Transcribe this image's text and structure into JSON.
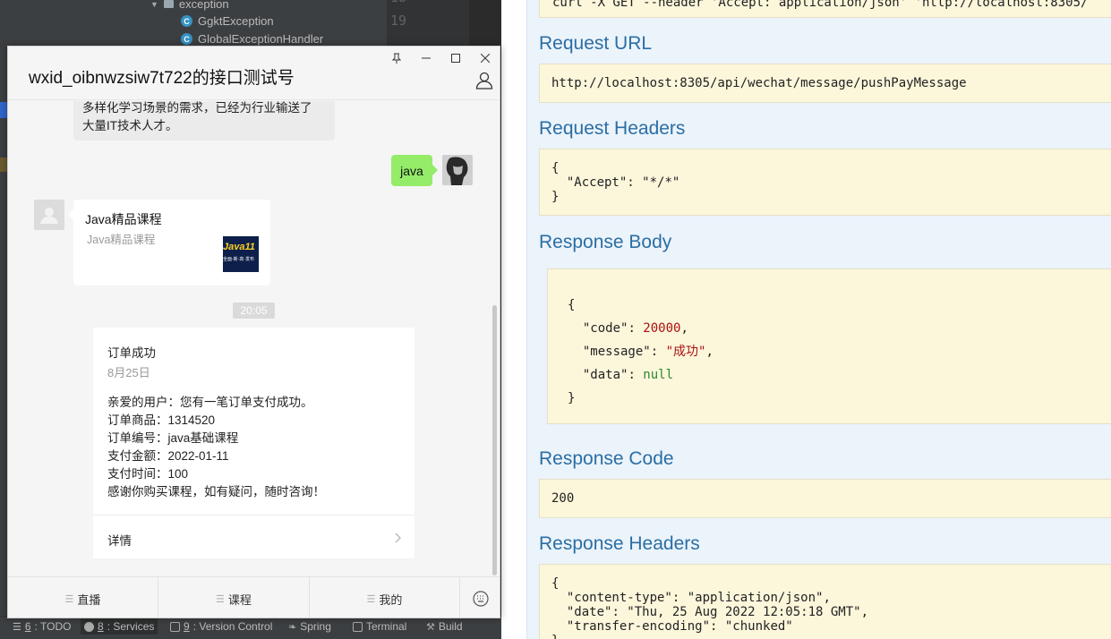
{
  "ide": {
    "tree": {
      "folder": "exception",
      "classes": [
        "GgktException",
        "GlobalExceptionHandler"
      ]
    },
    "line_numbers": [
      "19"
    ],
    "toolwindows": [
      {
        "num": "6",
        "label": ": TODO"
      },
      {
        "num": "8",
        "label": ": Services"
      },
      {
        "num": "9",
        "label": ": Version Control"
      },
      {
        "label": "Spring"
      },
      {
        "label": "Terminal"
      },
      {
        "label": "Build"
      }
    ]
  },
  "wechat": {
    "title": "wxid_oibnwzsiw7t722的接口测试号",
    "window_controls": {
      "pin": "⊥",
      "minimize": "—",
      "maximize": "☐",
      "close": "✕"
    },
    "messages": {
      "incoming_text": [
        "多样化学习场景的需求，已经为行业输送了",
        "大量IT技术人才。"
      ],
      "outgoing_text": "java",
      "link_card": {
        "title": "Java精品课程",
        "desc": "Java精品课程",
        "thumb_text": "Java11",
        "thumb_sub": "全面·新·高·发布"
      },
      "time": "20:05",
      "template": {
        "title": "订单成功",
        "date": "8月25日",
        "lines": [
          "亲爱的用户：您有一笔订单支付成功。",
          "订单商品：1314520",
          "订单编号：java基础课程",
          "支付金额：2022-01-11",
          "支付时间：100",
          "感谢你购买课程，如有疑问，随时咨询！"
        ],
        "detail_label": "详情"
      }
    },
    "menu": [
      "直播",
      "课程",
      "我的"
    ]
  },
  "swagger": {
    "curl_partial": "curl -X GET --header 'Accept: application/json' 'http://localhost:8305/",
    "request_url_heading": "Request URL",
    "request_url": "http://localhost:8305/api/wechat/message/pushPayMessage",
    "request_headers_heading": "Request Headers",
    "request_headers": {
      "key": "\"Accept\"",
      "value": "\"*/*\""
    },
    "response_body_heading": "Response Body",
    "response_body": {
      "code_key": "\"code\"",
      "code_val": "20000",
      "message_key": "\"message\"",
      "message_val": "\"成功\"",
      "data_key": "\"data\"",
      "data_val": "null"
    },
    "response_code_heading": "Response Code",
    "response_code": "200",
    "response_headers_heading": "Response Headers",
    "response_headers": [
      {
        "key": "\"content-type\"",
        "value": "\"application/json\""
      },
      {
        "key": "\"date\"",
        "value": "\"Thu, 25 Aug 2022 12:05:18 GMT\""
      },
      {
        "key": "\"transfer-encoding\"",
        "value": "\"chunked\""
      }
    ]
  }
}
